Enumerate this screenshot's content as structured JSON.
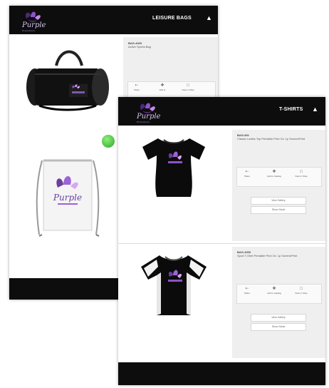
{
  "back_screen": {
    "brand": {
      "name": "Purple",
      "tagline": "Promotions"
    },
    "category_title": "LEISURE BAGS",
    "header_icon": "menu-icon",
    "product": {
      "code": "BAG-4020",
      "description": "Active Sports Bag",
      "actions": [
        {
          "label": "Share",
          "icon": "share-icon"
        },
        {
          "label": "Add to",
          "icon": "plus-icon"
        },
        {
          "label": "View in Shop",
          "icon": "bag-icon"
        }
      ]
    }
  },
  "front_screen": {
    "brand": {
      "name": "Purple",
      "tagline": "Promotions"
    },
    "category_title": "T-SHIRTS",
    "header_icon": "menu-icon",
    "products": [
      {
        "code": "BAG-801",
        "description": "Classic Ladies Top Printable Print Ov. 1p Screen/Print",
        "actions": [
          {
            "label": "Share",
            "icon": "share-icon"
          },
          {
            "label": "Add to Catalog",
            "icon": "plus-icon"
          },
          {
            "label": "View in Shop",
            "icon": "bag-icon"
          }
        ],
        "buttons": [
          "View Gallery",
          "Show Stock"
        ]
      },
      {
        "code": "BAG-3000",
        "description": "Sport T-Shirt Printable Print Ov. 1p Screen/Print",
        "actions": [
          {
            "label": "Share",
            "icon": "share-icon"
          },
          {
            "label": "Add to Catalog",
            "icon": "plus-icon"
          },
          {
            "label": "View in Shop",
            "icon": "bag-icon"
          }
        ],
        "buttons": [
          "View Gallery",
          "Show Stock"
        ]
      }
    ]
  },
  "colors": {
    "bar": "#0d0d0d",
    "panel": "#efefef",
    "brand_purple": "#6b3fa0",
    "status_green": "#3cb83a"
  }
}
